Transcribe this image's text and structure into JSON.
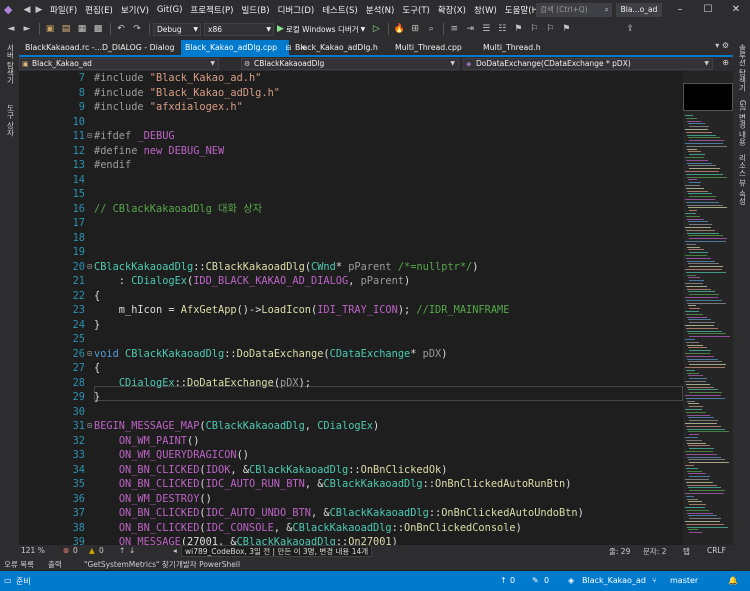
{
  "menu": {
    "items": [
      "파일(F)",
      "편집(E)",
      "보기(V)",
      "Git(G)",
      "프로젝트(P)",
      "빌드(B)",
      "디버그(D)",
      "테스트(S)",
      "분석(N)",
      "도구(T)",
      "확장(X)",
      "창(W)",
      "도움말(H)"
    ],
    "search_placeholder": "검색 (Ctrl+Q)",
    "solution_title": "Bla...o_ad"
  },
  "toolbar": {
    "config": "Debug",
    "platform": "x86",
    "run_label": "로컬 Windows 디버거"
  },
  "left_strip": [
    "서버 탐색기",
    "도구 상자"
  ],
  "right_strip": [
    "솔루션 탐색기",
    "Git 변경 내용",
    "리소스 뷰",
    "속성"
  ],
  "tabs": [
    {
      "label": "BlackKakaoad.rc -...D_DIALOG - Dialog",
      "active": false
    },
    {
      "label": "Black_Kakao_adDlg.cpp",
      "active": true
    },
    {
      "label": "Black_Kakao_adDlg.h",
      "active": false
    },
    {
      "label": "Multi_Thread.cpp",
      "active": false
    },
    {
      "label": "Multi_Thread.h",
      "active": false
    }
  ],
  "nav": {
    "project": "Black_Kakao_ad",
    "scope": "CBlackKakaoadDlg",
    "member": "DoDataExchange(CDataExchange * pDX)"
  },
  "code": {
    "line_numbers": [
      "7",
      "8",
      "9",
      "10",
      "11",
      "12",
      "13",
      "14",
      "15",
      "16",
      "17",
      "18",
      "19",
      "20",
      "21",
      "22",
      "23",
      "24",
      "25",
      "26",
      "27",
      "28",
      "29",
      "30",
      "31",
      "32",
      "33",
      "34",
      "35",
      "36",
      "37",
      "38",
      "39"
    ]
  },
  "editor_status": {
    "zoom": "121 %",
    "errors": "0",
    "warnings": "0",
    "line": "줄: 29",
    "col": "문자: 2",
    "indent": "탭",
    "eol": "CRLF",
    "tooltip": "wi789_CodeBox, 3일 전 | 만든 이 3명, 변경 내용 14개"
  },
  "toolwindows": [
    "오류 목록",
    "출력",
    "\"GetSystemMetrics\" 찾기",
    "개발자 PowerShell"
  ],
  "statusbar": {
    "ready": "준비",
    "up": "0",
    "pencil": "0",
    "repo": "Black_Kakao_ad",
    "branch": "master"
  }
}
